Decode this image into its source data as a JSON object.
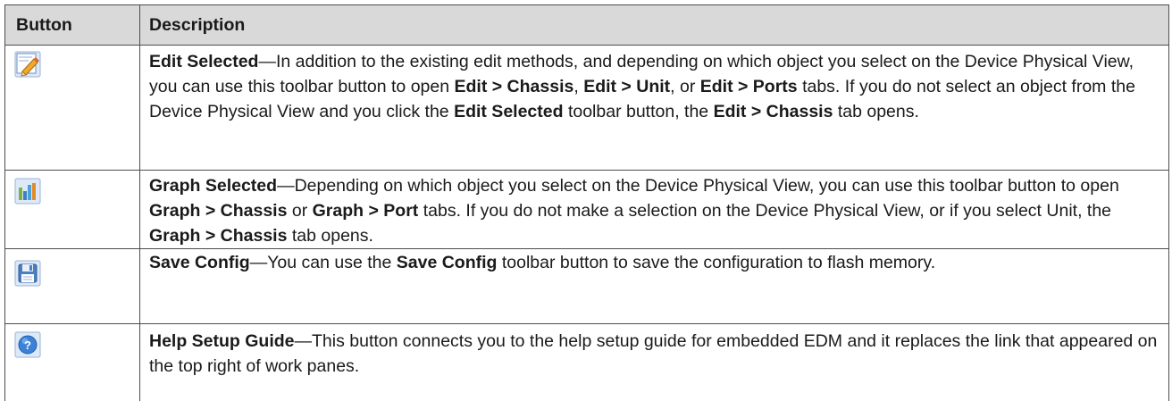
{
  "header": {
    "button": "Button",
    "description": "Description"
  },
  "rows": [
    {
      "icon": "edit-pencil-icon",
      "title": "Edit Selected",
      "parts": [
        "—In addition to the existing edit methods, and depending on which object you select on the Device Physical View, you can use this toolbar button to open ",
        "Edit > Chassis",
        ", ",
        "Edit > Unit",
        ", or ",
        "Edit > Ports",
        " tabs. If you do not select an object from the Device Physical View and you click the ",
        "Edit Selected",
        " toolbar button, the ",
        "Edit > Chassis",
        " tab opens."
      ]
    },
    {
      "icon": "bar-graph-icon",
      "title": "Graph Selected",
      "parts": [
        "—Depending on which object you select on the Device Physical View, you can use this toolbar button to open ",
        "Graph > Chassis",
        " or ",
        "Graph > Port",
        " tabs. If you do not make a selection on the Device Physical View, or if you select Unit, the ",
        "Graph > Chassis",
        " tab opens."
      ]
    },
    {
      "icon": "floppy-disk-icon",
      "title": "Save Config",
      "parts": [
        "—You can use the ",
        "Save Config",
        " toolbar button to save the configuration to flash memory."
      ]
    },
    {
      "icon": "help-question-icon",
      "title": "Help Setup Guide",
      "parts": [
        "—This button connects you to the help setup guide for embedded EDM and it replaces the link that appeared on the top right of work panes."
      ]
    }
  ]
}
